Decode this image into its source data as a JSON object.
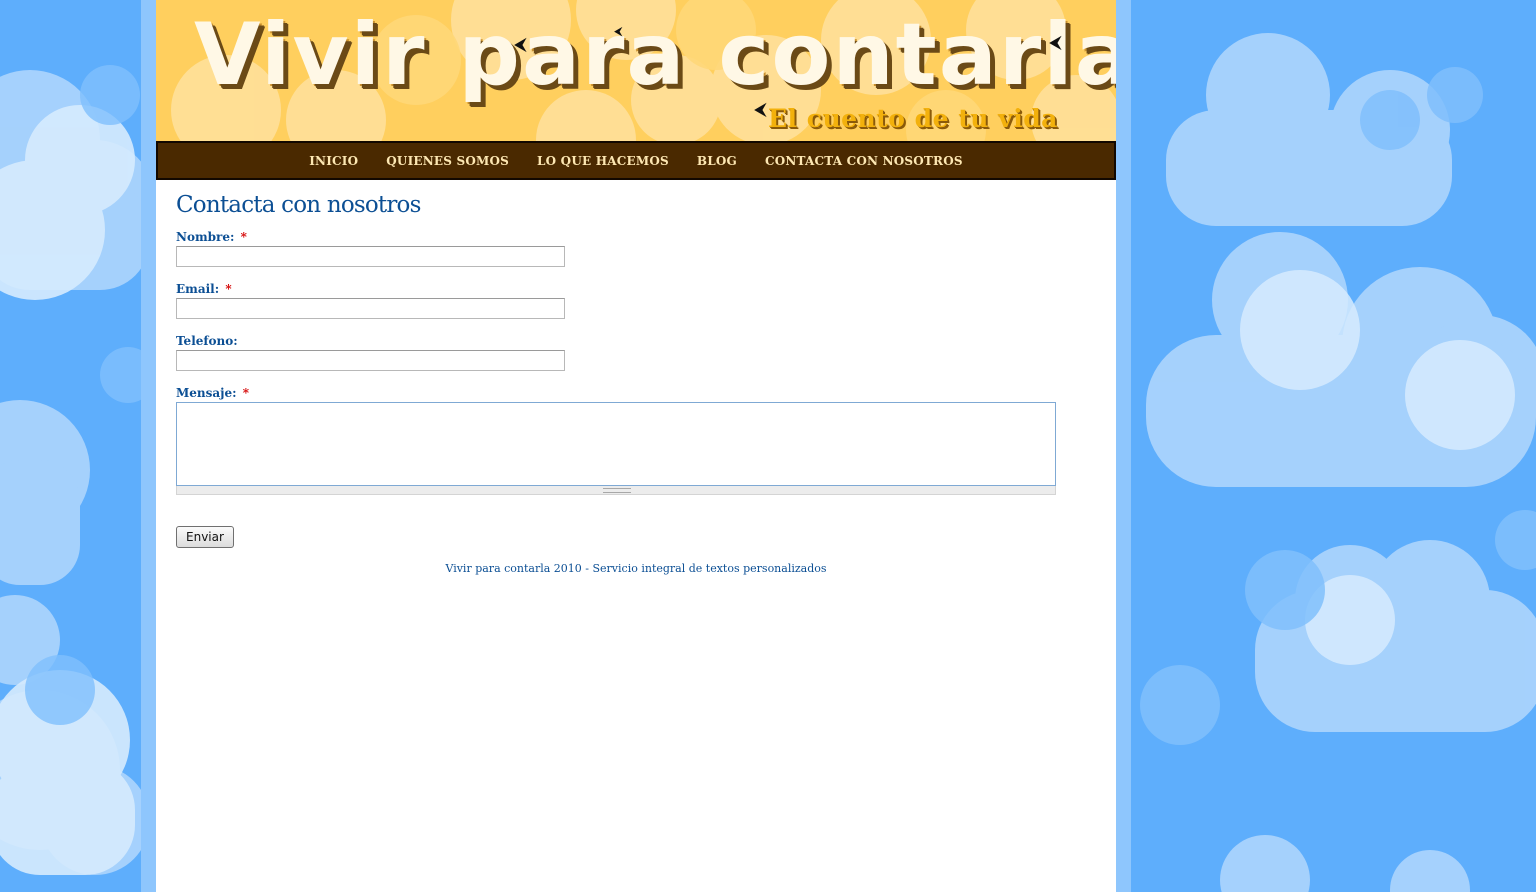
{
  "header": {
    "site_title": "Vivir para contarla",
    "site_subtitle": "El cuento de tu vida"
  },
  "nav": {
    "items": [
      {
        "label": "INICIO"
      },
      {
        "label": "QUIENES SOMOS"
      },
      {
        "label": "LO QUE HACEMOS"
      },
      {
        "label": "BLOG"
      },
      {
        "label": "CONTACTA CON NOSOTROS"
      }
    ]
  },
  "main": {
    "page_title": "Contacta con nosotros",
    "form": {
      "nombre_label": "Nombre:",
      "email_label": "Email:",
      "telefono_label": "Telefono:",
      "mensaje_label": "Mensaje:",
      "required_mark": "*",
      "nombre_value": "",
      "email_value": "",
      "telefono_value": "",
      "mensaje_value": "",
      "submit_label": "Enviar"
    }
  },
  "footer": {
    "text": "Vivir para contarla 2010 - Servicio integral de textos personalizados"
  },
  "colors": {
    "sky": "#5eaefc",
    "cloud": "#c6e2fd",
    "nav_bg": "#4a2900",
    "header_bg": "#ffcf5e",
    "link_blue": "#0c4f94",
    "required_red": "#d40000"
  }
}
